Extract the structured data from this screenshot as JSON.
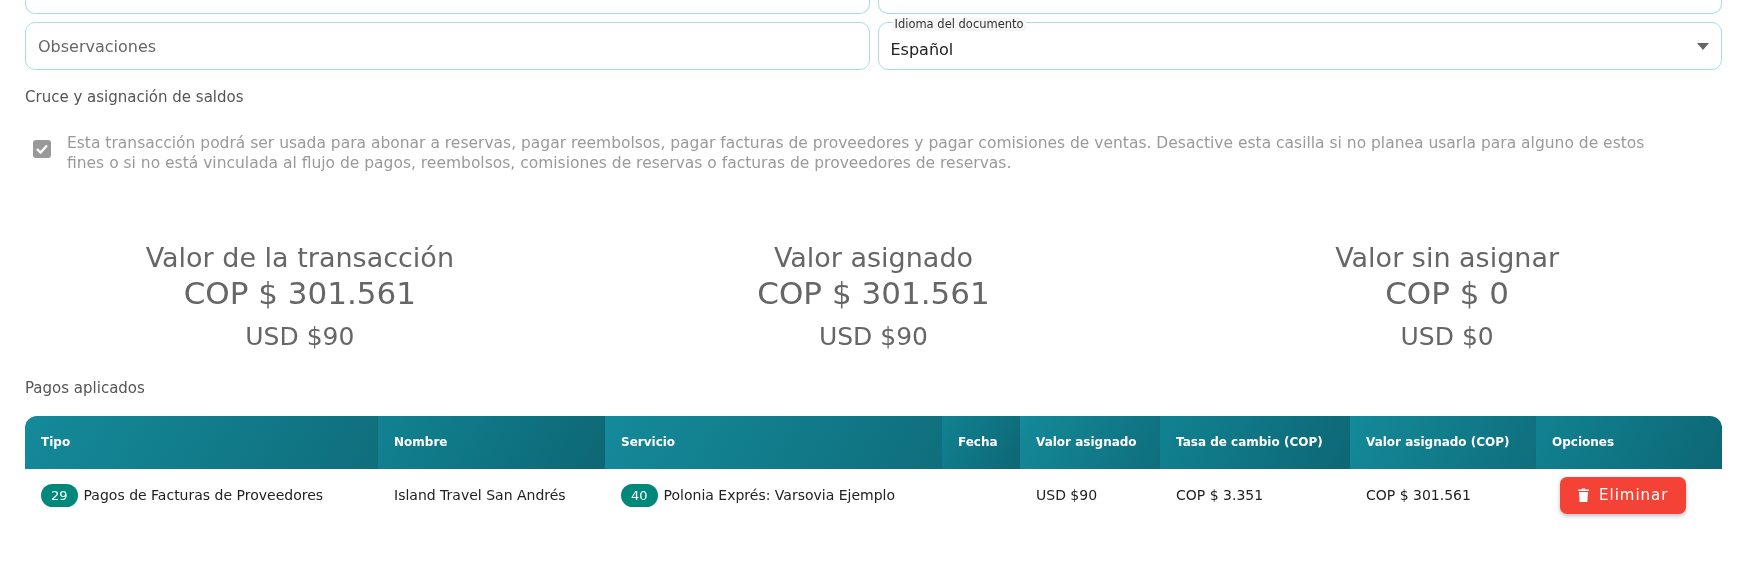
{
  "fields": [
    {
      "kind": "text",
      "placeholder": "Observaciones"
    },
    {
      "kind": "select",
      "label": "Idioma del documento",
      "value": "Español"
    }
  ],
  "section_title": "Cruce y asignación de saldos",
  "usable_checkbox": {
    "checked": true,
    "disabled": true,
    "text": "Esta transacción podrá ser usada para abonar a reservas, pagar reembolsos, pagar facturas de proveedores y pagar comisiones de ventas. Desactive esta casilla si no planea usarla para alguno de estos fines o si no está vinculada al flujo de pagos, reembolsos, comisiones de reservas o facturas de proveedores de reservas."
  },
  "summary": [
    {
      "title": "Valor de la transacción",
      "cop": "COP $ 301.561",
      "usd": "USD $90"
    },
    {
      "title": "Valor asignado",
      "cop": "COP $ 301.561",
      "usd": "USD $90"
    },
    {
      "title": "Valor sin asignar",
      "cop": "COP $ 0",
      "usd": "USD $0"
    }
  ],
  "payments_title": "Pagos aplicados",
  "table": {
    "columns": [
      "Tipo",
      "Nombre",
      "Servicio",
      "Fecha",
      "Valor asignado",
      "Tasa de cambio (COP)",
      "Valor asignado (COP)",
      "Opciones"
    ],
    "rows": [
      {
        "type_id": "29",
        "type": "Pagos de Facturas de Proveedores",
        "name": "Island Travel San Andrés",
        "service_id": "40",
        "service": "Polonia Exprés: Varsovia Ejemplo",
        "date": "",
        "assigned": "USD $90",
        "rate": "COP $ 3.351",
        "assigned_cop": "COP $ 301.561",
        "action": "Eliminar"
      }
    ]
  }
}
